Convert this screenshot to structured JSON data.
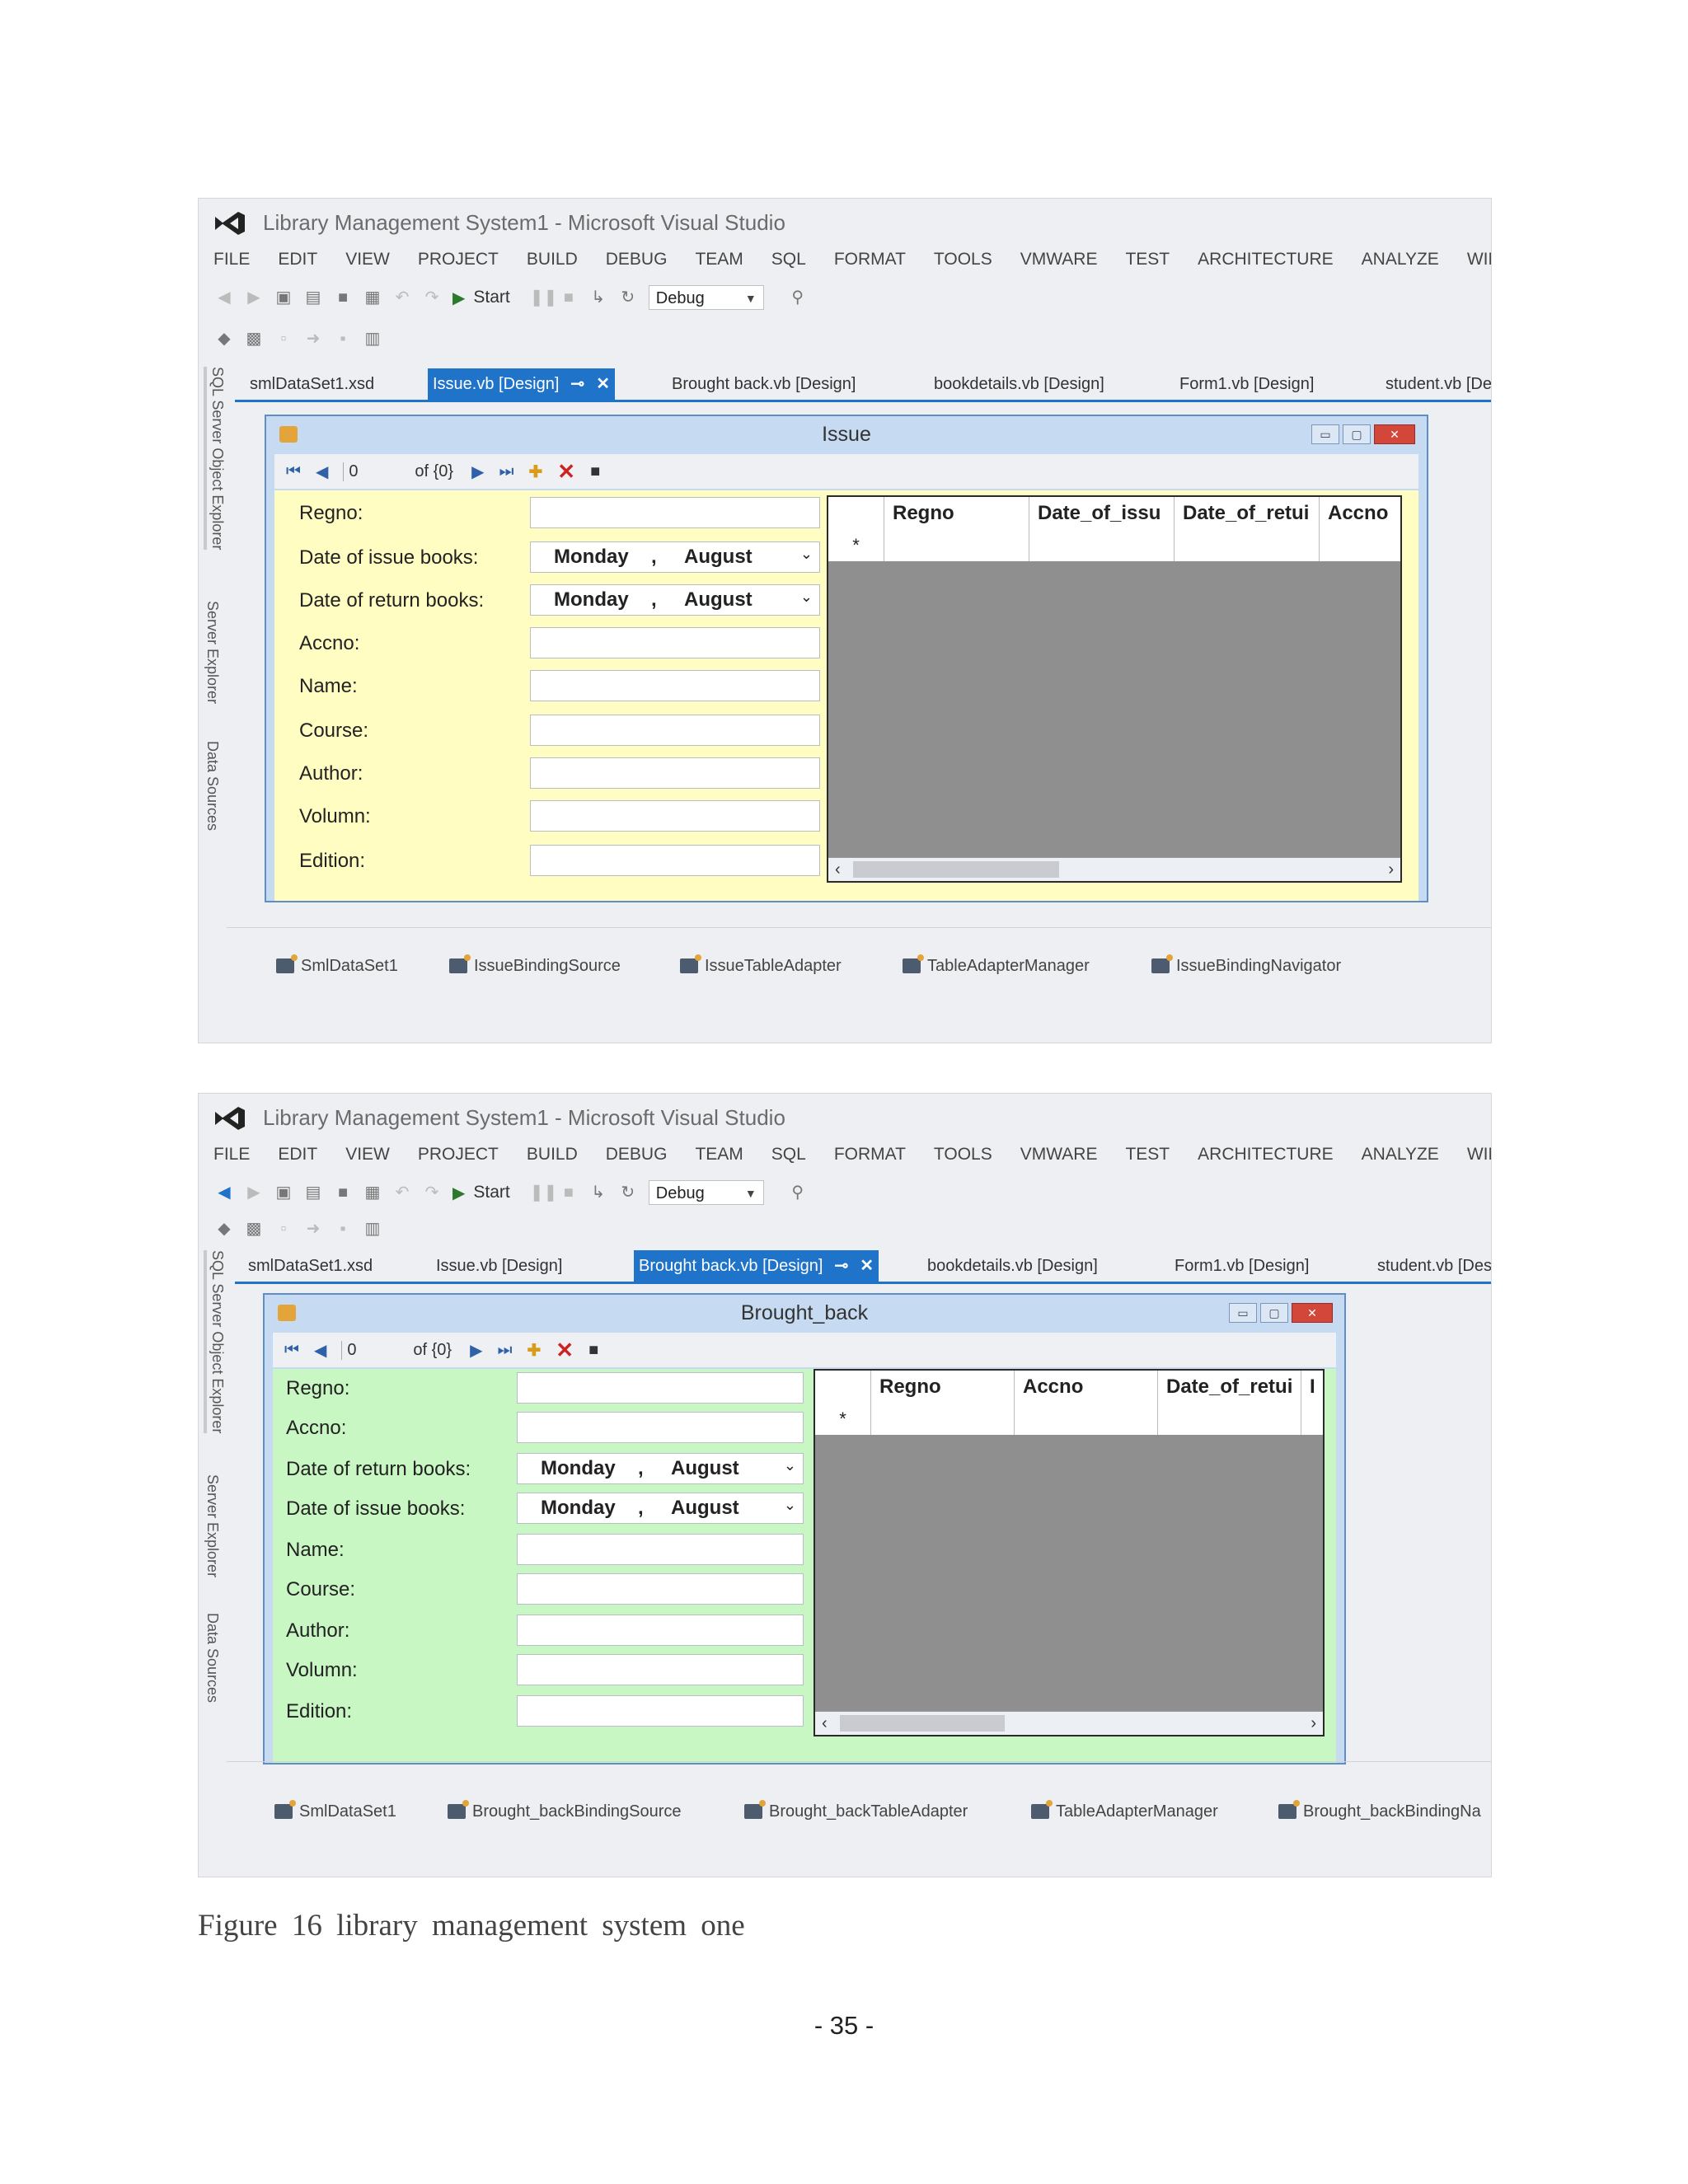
{
  "screenshots": [
    {
      "title": "Library Management System1 - Microsoft Visual Studio",
      "menu": [
        "FILE",
        "EDIT",
        "VIEW",
        "PROJECT",
        "BUILD",
        "DEBUG",
        "TEAM",
        "SQL",
        "FORMAT",
        "TOOLS",
        "VMWARE",
        "TEST",
        "ARCHITECTURE",
        "ANALYZE",
        "WINDOW"
      ],
      "start_label": "Start",
      "debug_config": "Debug",
      "side_tabs": [
        "SQL Server Object Explorer",
        "Server Explorer",
        "Data Sources"
      ],
      "doc_tabs": [
        "smlDataSet1.xsd",
        "Issue.vb [Design]",
        "Brought back.vb [Design]",
        "bookdetails.vb [Design]",
        "Form1.vb [Design]",
        "student.vb [Design]"
      ],
      "active_tab_index": 1,
      "form": {
        "title": "Issue",
        "nav_position": "0",
        "nav_count": "of {0}",
        "background": "#fffdc2",
        "fields": [
          {
            "label": "Regno:",
            "type": "text"
          },
          {
            "label": "Date of issue books:",
            "type": "date",
            "day": "Monday",
            "sep": ",",
            "month": "August"
          },
          {
            "label": "Date of return books:",
            "type": "date",
            "day": "Monday",
            "sep": ",",
            "month": "August"
          },
          {
            "label": "Accno:",
            "type": "text"
          },
          {
            "label": "Name:",
            "type": "text"
          },
          {
            "label": "Course:",
            "type": "text"
          },
          {
            "label": "Author:",
            "type": "text"
          },
          {
            "label": "Volumn:",
            "type": "text"
          },
          {
            "label": "Edition:",
            "type": "text"
          }
        ],
        "grid_columns": [
          "Regno",
          "Date_of_issu",
          "Date_of_retui",
          "Accno"
        ],
        "new_row_marker": "*"
      },
      "components": [
        "SmlDataSet1",
        "IssueBindingSource",
        "IssueTableAdapter",
        "TableAdapterManager",
        "IssueBindingNavigator"
      ]
    },
    {
      "title": "Library Management System1 - Microsoft Visual Studio",
      "menu": [
        "FILE",
        "EDIT",
        "VIEW",
        "PROJECT",
        "BUILD",
        "DEBUG",
        "TEAM",
        "SQL",
        "FORMAT",
        "TOOLS",
        "VMWARE",
        "TEST",
        "ARCHITECTURE",
        "ANALYZE",
        "WINDOW"
      ],
      "start_label": "Start",
      "debug_config": "Debug",
      "side_tabs": [
        "SQL Server Object Explorer",
        "Server Explorer",
        "Data Sources"
      ],
      "doc_tabs": [
        "smlDataSet1.xsd",
        "Issue.vb [Design]",
        "Brought back.vb [Design]",
        "bookdetails.vb [Design]",
        "Form1.vb [Design]",
        "student.vb [Design]"
      ],
      "active_tab_index": 2,
      "form": {
        "title": "Brought_back",
        "nav_position": "0",
        "nav_count": "of {0}",
        "background": "#c9f7c4",
        "fields": [
          {
            "label": "Regno:",
            "type": "text"
          },
          {
            "label": "Accno:",
            "type": "text"
          },
          {
            "label": "Date of return books:",
            "type": "date",
            "day": "Monday",
            "sep": ",",
            "month": "August"
          },
          {
            "label": "Date of issue books:",
            "type": "date",
            "day": "Monday",
            "sep": ",",
            "month": "August"
          },
          {
            "label": "Name:",
            "type": "text"
          },
          {
            "label": "Course:",
            "type": "text"
          },
          {
            "label": "Author:",
            "type": "text"
          },
          {
            "label": "Volumn:",
            "type": "text"
          },
          {
            "label": "Edition:",
            "type": "text"
          }
        ],
        "grid_columns": [
          "Regno",
          "Accno",
          "Date_of_retui",
          "I"
        ],
        "new_row_marker": "*"
      },
      "components": [
        "SmlDataSet1",
        "Brought_backBindingSource",
        "Brought_backTableAdapter",
        "TableAdapterManager",
        "Brought_backBindingNa"
      ]
    }
  ],
  "caption": "Figure 16 library management system one",
  "page_number": "- 35 -"
}
